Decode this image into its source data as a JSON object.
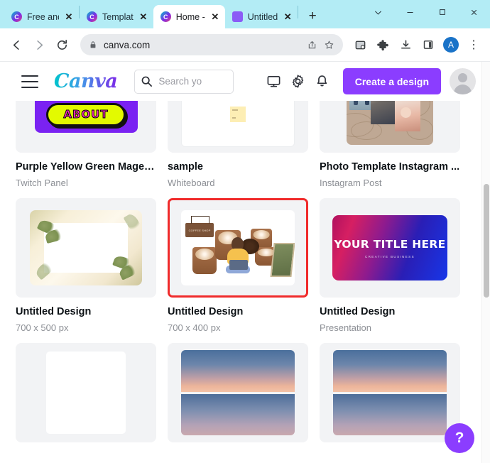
{
  "browser": {
    "tabs": [
      {
        "title": "Free and",
        "favicon": "canva-icon",
        "active": false
      },
      {
        "title": "Templat",
        "favicon": "canva-icon",
        "active": false
      },
      {
        "title": "Home -",
        "favicon": "canva-icon",
        "active": true
      },
      {
        "title": "Untitled",
        "favicon": "app-icon",
        "active": false
      }
    ],
    "new_tab_label": "+",
    "window_controls": {
      "expand": "⌄",
      "minimize": "−",
      "maximize": "□",
      "close": "✕"
    },
    "nav": {
      "back": "←",
      "forward": "→",
      "reload": "⟳"
    },
    "omnibox": {
      "url": "canva.com",
      "lock_icon": "lock-icon",
      "share_icon": "share-icon",
      "bookmark_icon": "star-icon"
    },
    "toolbar_icons": [
      "capture-icon",
      "extensions-icon",
      "downloads-icon",
      "side-panel-icon"
    ],
    "profile_initial": "A",
    "menu_icon": "⋮"
  },
  "canva": {
    "brand": "Canva",
    "menu_icon": "hamburger-icon",
    "search": {
      "placeholder": "Search yo"
    },
    "header_icons": [
      "monitor-icon",
      "gear-icon",
      "bell-icon"
    ],
    "create_button": "Create a design",
    "avatar": "user-avatar",
    "help_button": "?"
  },
  "designs": [
    {
      "title": "Purple Yellow Green Magen...",
      "subtitle": "Twitch Panel",
      "thumb": "twitch-about-panel",
      "thumb_text": "ABOUT",
      "selected": false
    },
    {
      "title": "sample",
      "subtitle": "Whiteboard",
      "thumb": "whiteboard-sticky",
      "selected": false
    },
    {
      "title": "Photo Template Instagram ...",
      "subtitle": "Instagram Post",
      "thumb": "photo-collage",
      "selected": false
    },
    {
      "title": "Untitled Design",
      "subtitle": "700 x 500 px",
      "thumb": "floral-frame",
      "selected": false
    },
    {
      "title": "Untitled Design",
      "subtitle": "700 x 400 px",
      "thumb": "coffee-shop-illustration",
      "thumb_text": "COFFEE SHOP",
      "selected": true
    },
    {
      "title": "Untitled Design",
      "subtitle": "Presentation",
      "thumb": "gradient-title",
      "thumb_text": "YOUR TITLE HERE",
      "thumb_subtext": "CREATIVE BUSINESS",
      "selected": false
    },
    {
      "title": "",
      "subtitle": "",
      "thumb": "blank-document",
      "selected": false
    },
    {
      "title": "",
      "subtitle": "",
      "thumb": "sunset-sky",
      "selected": false
    },
    {
      "title": "",
      "subtitle": "",
      "thumb": "sunset-sky",
      "selected": false
    }
  ],
  "colors": {
    "tabstrip": "#b3ecf5",
    "canva_purple": "#8b3dff",
    "selection_red": "#f02b2b",
    "card_bg": "#f2f3f5"
  }
}
